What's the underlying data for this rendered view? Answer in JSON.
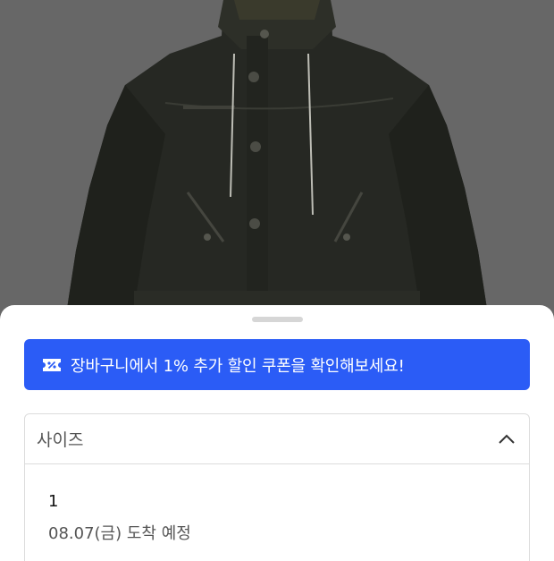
{
  "product": {
    "image_icon": "jacket-photo"
  },
  "coupon_banner": {
    "text": "장바구니에서 1% 추가 할인 쿠폰을 확인해보세요!",
    "icon": "coupon-percent-icon",
    "color": "#2b5cf6"
  },
  "size_select": {
    "label": "사이즈",
    "icon": "chevron-up-icon",
    "options": [
      {
        "size": "1",
        "eta": "08.07(금) 도착 예정"
      }
    ]
  }
}
